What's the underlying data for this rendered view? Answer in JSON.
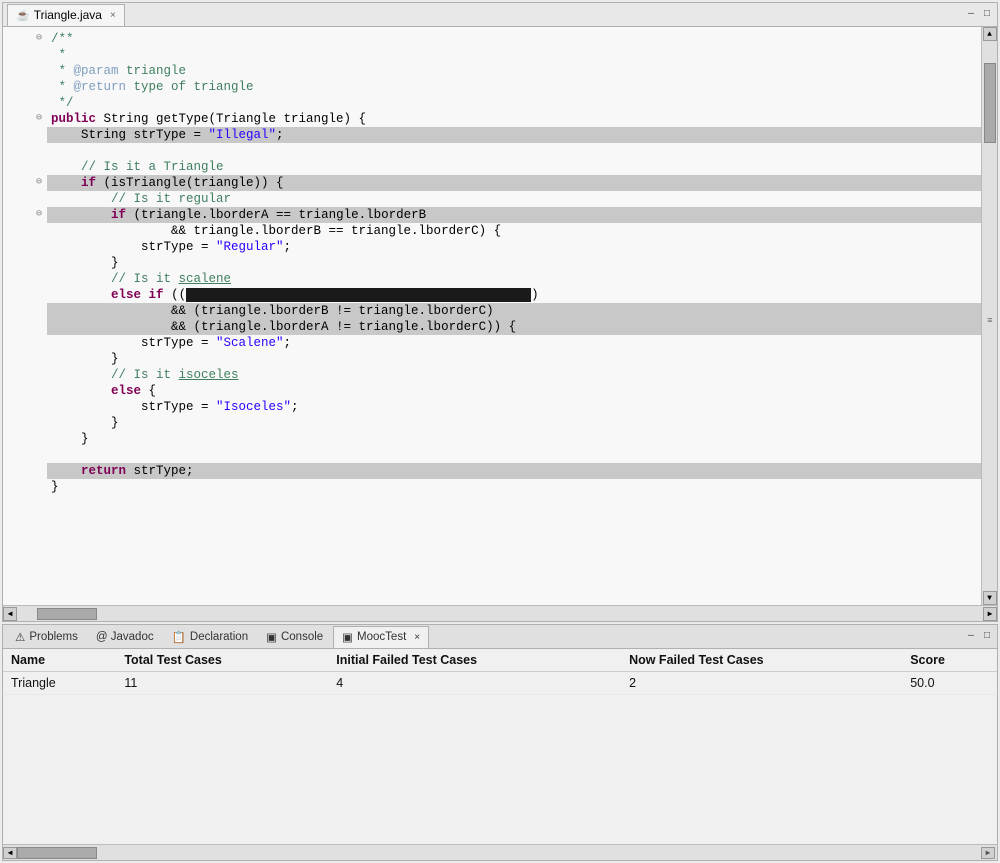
{
  "editor": {
    "tab_label": "Triangle.java",
    "tab_icon": "☕",
    "close_icon": "×",
    "minimize_icon": "—",
    "maximize_icon": "□",
    "code_lines": [
      {
        "indent": 0,
        "fold": "⊖",
        "content": "/**",
        "type": "comment"
      },
      {
        "indent": 0,
        "fold": " ",
        "content": " *",
        "type": "comment"
      },
      {
        "indent": 0,
        "fold": " ",
        "content": " * @param triangle",
        "type": "javadoc"
      },
      {
        "indent": 0,
        "fold": " ",
        "content": " * @return type of triangle",
        "type": "javadoc"
      },
      {
        "indent": 0,
        "fold": " ",
        "content": " */",
        "type": "comment"
      },
      {
        "indent": 0,
        "fold": "⊖",
        "content": "public String getType(Triangle triangle) {",
        "type": "code"
      },
      {
        "indent": 1,
        "fold": " ",
        "content": "String strType = \"Illegal\";",
        "type": "code",
        "highlight": true
      },
      {
        "indent": 1,
        "fold": " ",
        "content": "",
        "type": "code"
      },
      {
        "indent": 1,
        "fold": " ",
        "content": "// Is it a Triangle",
        "type": "comment"
      },
      {
        "indent": 1,
        "fold": "⊖",
        "content": "if (isTriangle(triangle)) {",
        "type": "code",
        "highlight": true
      },
      {
        "indent": 2,
        "fold": " ",
        "content": "// Is it regular",
        "type": "comment"
      },
      {
        "indent": 2,
        "fold": "⊖",
        "content": "if (triangle.lborderA == triangle.lborderB",
        "type": "code",
        "highlight": true
      },
      {
        "indent": 3,
        "fold": " ",
        "content": "&& triangle.lborderB == triangle.lborderC) {",
        "type": "code"
      },
      {
        "indent": 3,
        "fold": " ",
        "content": "strType = \"Regular\";",
        "type": "code"
      },
      {
        "indent": 2,
        "fold": " ",
        "content": "}",
        "type": "code"
      },
      {
        "indent": 2,
        "fold": " ",
        "content": "// Is it scalene",
        "type": "comment"
      },
      {
        "indent": 2,
        "fold": " ",
        "content": "else if ((",
        "type": "code",
        "black_highlight": true
      },
      {
        "indent": 3,
        "fold": " ",
        "content": "&& (triangle.lborderB != triangle.lborderC)",
        "type": "code",
        "highlight": true
      },
      {
        "indent": 3,
        "fold": " ",
        "content": "&& (triangle.lborderA != triangle.lborderC)) {",
        "type": "code",
        "highlight": true
      },
      {
        "indent": 3,
        "fold": " ",
        "content": "strType = \"Scalene\";",
        "type": "code"
      },
      {
        "indent": 2,
        "fold": " ",
        "content": "}",
        "type": "code"
      },
      {
        "indent": 2,
        "fold": " ",
        "content": "// Is it isoceles",
        "type": "comment"
      },
      {
        "indent": 2,
        "fold": " ",
        "content": "else {",
        "type": "code"
      },
      {
        "indent": 3,
        "fold": " ",
        "content": "strType = \"Isoceles\";",
        "type": "code"
      },
      {
        "indent": 2,
        "fold": " ",
        "content": "}",
        "type": "code"
      },
      {
        "indent": 1,
        "fold": " ",
        "content": "}",
        "type": "code"
      },
      {
        "indent": 1,
        "fold": " ",
        "content": "",
        "type": "code"
      },
      {
        "indent": 1,
        "fold": " ",
        "content": "return strType;",
        "type": "code",
        "highlight": true
      },
      {
        "indent": 0,
        "fold": " ",
        "content": "}",
        "type": "code"
      }
    ]
  },
  "bottom_panel": {
    "tabs": [
      {
        "label": "Problems",
        "icon": "⚠",
        "active": false
      },
      {
        "label": "@ Javadoc",
        "icon": "",
        "active": false
      },
      {
        "label": "Declaration",
        "icon": "",
        "active": false
      },
      {
        "label": "Console",
        "icon": "▣",
        "active": false
      },
      {
        "label": "MoocTest",
        "icon": "▣",
        "active": true
      }
    ],
    "close_icon": "—",
    "maximize_icon": "□",
    "table": {
      "headers": [
        "Name",
        "Total Test Cases",
        "Initial Failed Test Cases",
        "Now Failed Test Cases",
        "Score"
      ],
      "rows": [
        {
          "name": "Triangle",
          "total": "11",
          "initial_failed": "4",
          "now_failed": "2",
          "score": "50.0"
        }
      ]
    }
  }
}
